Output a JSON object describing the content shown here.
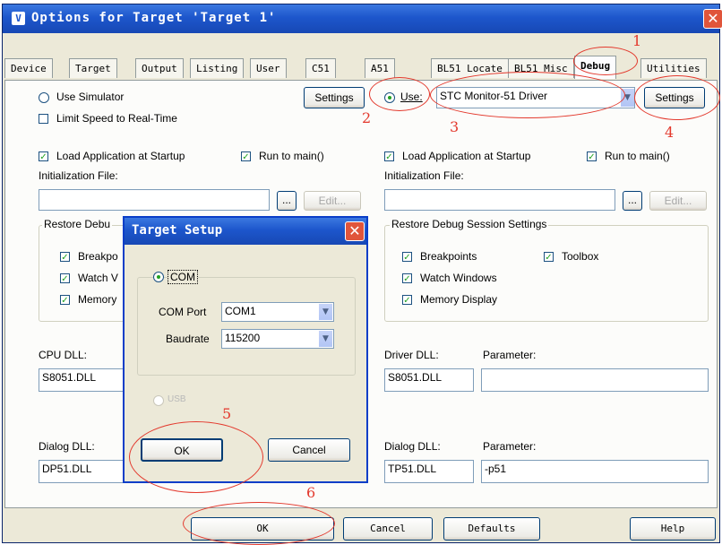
{
  "window": {
    "icon": "V",
    "title": "Options for Target 'Target 1'",
    "close_glyph": "✕"
  },
  "tabs": [
    "Device",
    "Target",
    "Output",
    "Listing",
    "User",
    "C51",
    "A51",
    "BL51 Locate",
    "BL51 Misc",
    "Debug",
    "Utilities"
  ],
  "active_tab": "Debug",
  "left": {
    "use_simulator": "Use Simulator",
    "limit_speed": "Limit Speed to Real-Time",
    "settings_button": "Settings",
    "load_app": "Load Application at Startup",
    "run_to_main": "Run to main()",
    "init_file_label": "Initialization File:",
    "browse": "...",
    "edit": "Edit...",
    "restore_group": "Restore Debu",
    "breakpoints": "Breakpo",
    "watch": "Watch V",
    "memory": "Memory",
    "cpu_dll_label": "CPU DLL:",
    "cpu_dll_value": "S8051.DLL",
    "dialog_dll_label": "Dialog DLL:",
    "dialog_dll_value": "DP51.DLL"
  },
  "right": {
    "use_label": "Use:",
    "driver": "STC Monitor-51 Driver",
    "settings_button": "Settings",
    "load_app": "Load Application at Startup",
    "run_to_main": "Run to main()",
    "init_file_label": "Initialization File:",
    "browse": "...",
    "edit": "Edit...",
    "restore_group": "Restore Debug Session Settings",
    "breakpoints": "Breakpoints",
    "toolbox": "Toolbox",
    "watch": "Watch Windows",
    "memory": "Memory Display",
    "driver_dll_label": "Driver DLL:",
    "driver_dll_value": "S8051.DLL",
    "driver_param_label": "Parameter:",
    "driver_param_value": "",
    "dialog_dll_label": "Dialog DLL:",
    "dialog_dll_value": "TP51.DLL",
    "dialog_param_label": "Parameter:",
    "dialog_param_value": "-p51"
  },
  "bottom": {
    "ok": "OK",
    "cancel": "Cancel",
    "defaults": "Defaults",
    "help": "Help"
  },
  "dialog": {
    "title": "Target Setup",
    "close_glyph": "✕",
    "com_label": "COM",
    "com_port_label": "COM Port",
    "com_port_value": "COM1",
    "baud_label": "Baudrate",
    "baud_value": "115200",
    "usb_label": "USB",
    "ok": "OK",
    "cancel": "Cancel"
  },
  "annotations": [
    "1",
    "2",
    "3",
    "4",
    "5",
    "6"
  ],
  "check_glyph": "✓",
  "arrow_glyph": "▼",
  "colors": {
    "title_blue": "#1d56cc",
    "annotation_red": "#e3382c",
    "check_green": "#21a121"
  }
}
